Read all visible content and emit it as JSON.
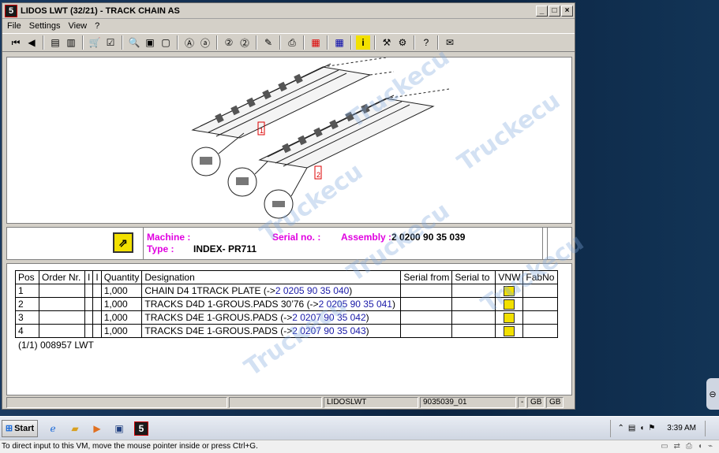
{
  "window": {
    "title": "LIDOS LWT (32/21) - TRACK CHAIN AS",
    "icon": "app-logo-icon"
  },
  "menu": [
    "File",
    "Settings",
    "View",
    "?"
  ],
  "toolbar": [
    "first-icon",
    "prev-icon",
    "doc-icon",
    "doc2-icon",
    "basket-icon",
    "checklist-icon",
    "zoom-icon",
    "page-icon",
    "page2-icon",
    "a-icon",
    "a-link-icon",
    "two-icon",
    "two-link-icon",
    "edit-icon",
    "print-icon",
    "grid-red-icon",
    "grid-blue-icon",
    "info-icon",
    "tools-icon",
    "parts-icon",
    "lidos-help-icon",
    "mail-icon"
  ],
  "drawing": {
    "labels": [
      "1",
      "2"
    ]
  },
  "info": {
    "machine_label": "Machine :",
    "type_label": "Type :",
    "type_value": "INDEX- PR711",
    "serial_label": "Serial no. :",
    "assembly_label": "Assembly :",
    "assembly_value": "2 0200 90 35 039"
  },
  "table": {
    "headers": [
      "Pos",
      "Order Nr.",
      "I",
      "I",
      "Quantity",
      "Designation",
      "Serial from",
      "Serial to",
      "VNW",
      "FabNo"
    ],
    "rows": [
      {
        "pos": "1",
        "qty": "1,000",
        "desc": "CHAIN D4 1TRACK PLATE (->",
        "ref": "2 0205 90 35 040",
        "close": ")"
      },
      {
        "pos": "2",
        "qty": "1,000",
        "desc": "TRACKS D4D 1-GROUS.PADS 30’76 (->",
        "ref": "2 0205 90 35 041",
        "close": ")"
      },
      {
        "pos": "3",
        "qty": "1,000",
        "desc": "TRACKS D4E 1-GROUS.PADS (->",
        "ref": "2 0207 90 35 042",
        "close": ")"
      },
      {
        "pos": "4",
        "qty": "1,000",
        "desc": "TRACKS D4E 1-GROUS.PADS (->",
        "ref": "2 0207 90 35 043",
        "close": ")"
      }
    ],
    "footer": "(1/1) 008957 LWT"
  },
  "status": {
    "s1": "",
    "s2": "LIDOSLWT",
    "s3": "9035039_01",
    "s4": "-",
    "s5": "GB",
    "s6": "GB"
  },
  "taskbar": {
    "start": "Start",
    "time": "3:39 AM"
  },
  "vm_message": "To direct input to this VM, move the mouse pointer inside or press Ctrl+G.",
  "watermarks": [
    "Truckecu",
    "Truckecu",
    "Truckecu",
    "Truckecu",
    "Truckecu",
    "Truckecu"
  ]
}
